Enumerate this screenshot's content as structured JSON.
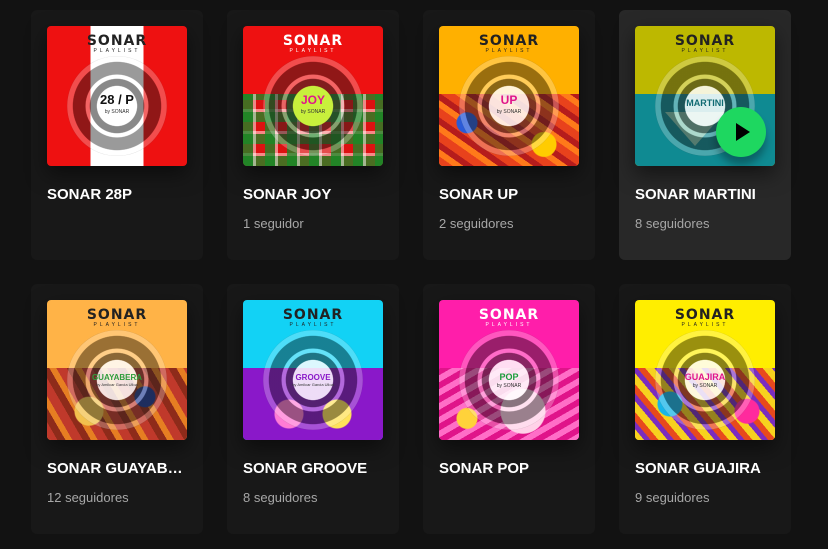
{
  "cards": [
    {
      "title": "SONAR 28P",
      "followers": "",
      "brand": "SONAR",
      "brand_sub": "PLAYLIST",
      "label": "28 / P",
      "label_sub": "by SONAR"
    },
    {
      "title": "SONAR JOY",
      "followers": "1 seguidor",
      "brand": "SONAR",
      "brand_sub": "PLAYLIST",
      "label": "JOY",
      "label_sub": "by SONAR"
    },
    {
      "title": "SONAR UP",
      "followers": "2 seguidores",
      "brand": "SONAR",
      "brand_sub": "PLAYLIST",
      "label": "UP",
      "label_sub": "by SONAR"
    },
    {
      "title": "SONAR MARTINI",
      "followers": "8 seguidores",
      "brand": "SONAR",
      "brand_sub": "PLAYLIST",
      "label": "MARTINI",
      "label_sub": ""
    },
    {
      "title": "SONAR GUAYABERA",
      "followers": "12 seguidores",
      "brand": "SONAR",
      "brand_sub": "PLAYLIST",
      "label": "GUAYABERA",
      "label_sub": "by Amilcar Garcia Ulloa"
    },
    {
      "title": "SONAR GROOVE",
      "followers": "8 seguidores",
      "brand": "SONAR",
      "brand_sub": "PLAYLIST",
      "label": "GROOVE",
      "label_sub": "by Amilcar Garcia Ulloa"
    },
    {
      "title": "SONAR POP",
      "followers": "",
      "brand": "SONAR",
      "brand_sub": "PLAYLIST",
      "label": "POP",
      "label_sub": "by SONAR"
    },
    {
      "title": "SONAR GUAJIRA",
      "followers": "9 seguidores",
      "brand": "SONAR",
      "brand_sub": "PLAYLIST",
      "label": "GUAJIRA",
      "label_sub": "by SONAR"
    }
  ],
  "colors": {
    "background": "#121212",
    "card": "#181818",
    "card_hover": "#282828",
    "play_button": "#1ed760",
    "muted_text": "#a7a7a7"
  },
  "hovered_card": "SONAR MARTINI",
  "play_icon": "play-icon"
}
